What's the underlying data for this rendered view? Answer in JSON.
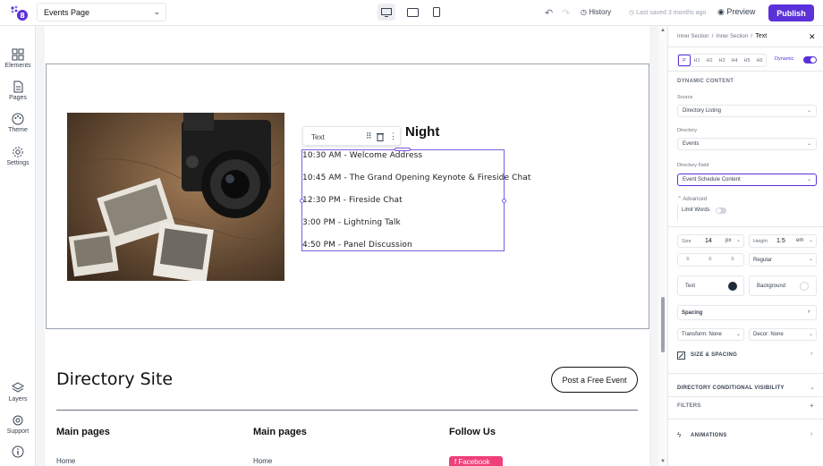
{
  "topbar": {
    "page_name": "Events Page",
    "history_label": "History",
    "saved_text": "Last saved 3 months ago",
    "preview_label": "Preview",
    "publish_label": "Publish"
  },
  "leftbar": {
    "elements": "Elements",
    "pages": "Pages",
    "theme": "Theme",
    "settings": "Settings",
    "layers": "Layers",
    "support": "Support"
  },
  "canvas": {
    "heading_visible": "Night",
    "toolbar_label": "Text",
    "schedule": [
      "10:30 AM - Welcome Address",
      "10:45 AM - The Grand Opening Keynote & Fireside Chat",
      "12:30 PM - Fireside Chat",
      "3:00 PM - Lightning Talk",
      "4:50 PM - Panel Discussion"
    ],
    "footer": {
      "site_title": "Directory Site",
      "post_button": "Post a Free Event",
      "col1_heading": "Main pages",
      "col2_heading": "Main pages",
      "col3_heading": "Follow Us",
      "col1_link": "Home",
      "col2_link": "Home",
      "social_button": "Facebook"
    }
  },
  "panel": {
    "breadcrumb": [
      "Inner Section",
      "Inner Section",
      "Text"
    ],
    "tags": [
      "P",
      "H1",
      "H2",
      "H3",
      "H4",
      "H5",
      "H6"
    ],
    "dynamic_label": "Dynamic",
    "dynamic_content_heading": "DYNAMIC CONTENT",
    "source_label": "Source",
    "source_value": "Directory Listing",
    "directory_label": "Directory",
    "directory_value": "Events",
    "field_label": "Directory Field",
    "field_value": "Event Schedule Content",
    "advanced_label": "Advanced",
    "limit_words_label": "Limit Words",
    "size_label": "Size",
    "size_value": "14",
    "size_unit": "px",
    "height_label": "Height",
    "height_value": "1.5",
    "height_unit": "em",
    "weight_value": "Regular",
    "text_color_label": "Text",
    "bg_color_label": "Background",
    "spacing_label": "Spacing",
    "transform_value": "Transform: None",
    "decor_value": "Decor: None",
    "size_spacing_label": "SIZE & SPACING",
    "visibility_label": "DIRECTORY CONDITIONAL VISIBILITY",
    "filters_label": "FILTERS",
    "animations_label": "ANIMATIONS"
  },
  "colors": {
    "accent": "#5b31d9",
    "text_swatch": "#1e293b",
    "social": "#ef3f79"
  }
}
